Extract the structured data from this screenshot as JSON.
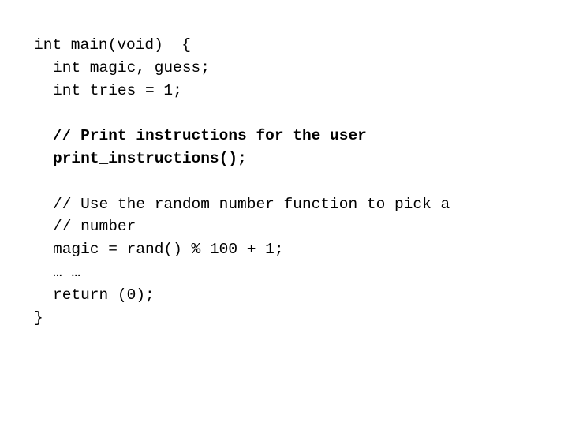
{
  "code": {
    "lines": [
      {
        "text": "int main(void)  {",
        "indent": 0,
        "bold": false
      },
      {
        "text": "int magic, guess;",
        "indent": 1,
        "bold": false
      },
      {
        "text": "int tries = 1;",
        "indent": 1,
        "bold": false
      },
      {
        "text": "",
        "indent": 0,
        "bold": false
      },
      {
        "text": "// Print instructions for the user",
        "indent": 1,
        "bold": true
      },
      {
        "text": "print_instructions();",
        "indent": 1,
        "bold": true
      },
      {
        "text": "",
        "indent": 0,
        "bold": false
      },
      {
        "text": "// Use the random number function to pick a",
        "indent": 1,
        "bold": false
      },
      {
        "text": "// number",
        "indent": 1,
        "bold": false
      },
      {
        "text": "magic = rand() % 100 + 1;",
        "indent": 1,
        "bold": false
      },
      {
        "text": "… …",
        "indent": 1,
        "bold": false
      },
      {
        "text": "return (0);",
        "indent": 1,
        "bold": false
      },
      {
        "text": "}",
        "indent": 0,
        "bold": false
      }
    ]
  }
}
